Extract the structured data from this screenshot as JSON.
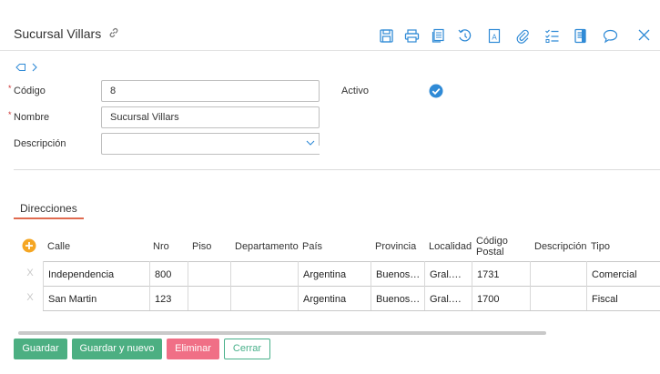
{
  "header": {
    "title": "Sucursal Villars"
  },
  "toolbar": {
    "icons": [
      "save-icon",
      "print-icon",
      "copy-icon",
      "history-icon",
      "translate-icon",
      "attach-icon",
      "checklist-icon",
      "document-icon",
      "chat-icon",
      "close-icon"
    ]
  },
  "form": {
    "codigo_label": "Código",
    "codigo_value": "8",
    "nombre_label": "Nombre",
    "nombre_value": "Sucursal Villars",
    "descripcion_label": "Descripción",
    "descripcion_value": "",
    "activo_label": "Activo",
    "activo_checked": true,
    "required_mark": "*"
  },
  "tabs": {
    "direcciones": "Direcciones"
  },
  "table": {
    "headers": {
      "calle": "Calle",
      "nro": "Nro",
      "piso": "Piso",
      "departamento": "Departamento",
      "pais": "País",
      "provincia": "Provincia",
      "localidad": "Localidad",
      "codigo_postal_1": "Código",
      "codigo_postal_2": "Postal",
      "descripcion": "Descripción",
      "tipo": "Tipo"
    },
    "delete_glyph": "X",
    "rows": [
      {
        "calle": "Independencia",
        "nro": "800",
        "piso": "",
        "departamento": "",
        "pais": "Argentina",
        "provincia": "Buenos…",
        "localidad": "Gral.…",
        "cp": "1731",
        "descripcion": "",
        "tipo": "Comercial"
      },
      {
        "calle": "San Martin",
        "nro": "123",
        "piso": "",
        "departamento": "",
        "pais": "Argentina",
        "provincia": "Buenos…",
        "localidad": "Gral.…",
        "cp": "1700",
        "descripcion": "",
        "tipo": "Fiscal"
      }
    ]
  },
  "footer": {
    "guardar": "Guardar",
    "guardar_nuevo": "Guardar y nuevo",
    "eliminar": "Eliminar",
    "cerrar": "Cerrar"
  },
  "colors": {
    "accent_blue": "#2f8ad6",
    "tab_underline": "#e06a4f",
    "button_green": "#4caf82",
    "button_red": "#f06f86",
    "add_orange": "#f5a623"
  }
}
